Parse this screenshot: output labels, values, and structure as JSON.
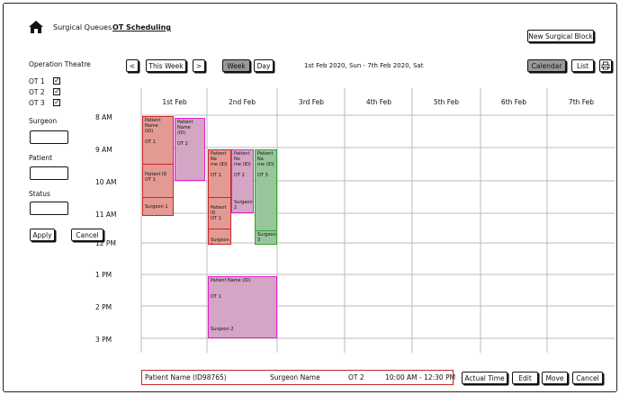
{
  "nav": {
    "queues": "Surgical Queues",
    "scheduling": "OT Scheduling"
  },
  "header": {
    "new_block": "New Surgical Block",
    "calendar": "Calendar",
    "list": "List"
  },
  "toolbar": {
    "prev": "<",
    "this_week": "This Week",
    "next": ">",
    "week": "Week",
    "day": "Day",
    "range": "1st Feb 2020, Sun - 7th Feb 2020, Sat"
  },
  "filters": {
    "title": "Operation Theatre",
    "ots": [
      {
        "label": "OT 1",
        "checked": true
      },
      {
        "label": "OT 2",
        "checked": true
      },
      {
        "label": "OT 3",
        "checked": true
      }
    ],
    "surgeon": "Surgeon",
    "patient": "Patient",
    "status": "Status",
    "apply": "Apply",
    "cancel": "Cancel"
  },
  "days": [
    "1st Feb",
    "2nd Feb",
    "3rd Feb",
    "4th Feb",
    "5th Feb",
    "6th Feb",
    "7th Feb"
  ],
  "times": [
    "8 AM",
    "9 AM",
    "10 AM",
    "11 AM",
    "12 PM",
    "1 PM",
    "2 PM",
    "3 PM"
  ],
  "events": [
    {
      "lines": [
        "Patient Name",
        "(ID)",
        "",
        "OT 1",
        "",
        "",
        "",
        "",
        "",
        "Patient ID",
        "OT 1",
        "",
        "",
        "",
        "",
        "Surgeon 1"
      ]
    },
    {
      "lines": [
        "Patient Name",
        "(ID)",
        "",
        "OT 2",
        "",
        "",
        "",
        "",
        "",
        "",
        "",
        "",
        "",
        "Surgeon 2"
      ]
    },
    {
      "lines": [
        "Patient Na",
        "me (ID)",
        "",
        "OT 1",
        "",
        "",
        "",
        "",
        "",
        "Patient ID",
        "OT 1",
        "",
        "",
        "",
        "Surgeon",
        "1"
      ]
    },
    {
      "lines": [
        "Patient No",
        "me (ID)",
        "",
        "OT 2",
        "",
        "",
        "",
        "",
        "Surgeon",
        "2"
      ]
    },
    {
      "lines": [
        "Patient Na",
        "me (ID)",
        "",
        "OT 3",
        "",
        "",
        "",
        "",
        "",
        "",
        "",
        "",
        "",
        "",
        "Surgeon",
        "3"
      ]
    },
    {
      "lines": [
        "Patient Name (ID)",
        "",
        "",
        "OT 1",
        "",
        "",
        "",
        "",
        "",
        "Surgeon 2"
      ]
    }
  ],
  "detail": {
    "patient": "Patient Name (ID98765)",
    "surgeon": "Surgeon Name",
    "ot": "OT 2",
    "time": "10:00 AM - 12:30 PM"
  },
  "actions": {
    "actual_time": "Actual Time",
    "edit": "Edit",
    "move": "Move",
    "cancel": "Cancel"
  }
}
